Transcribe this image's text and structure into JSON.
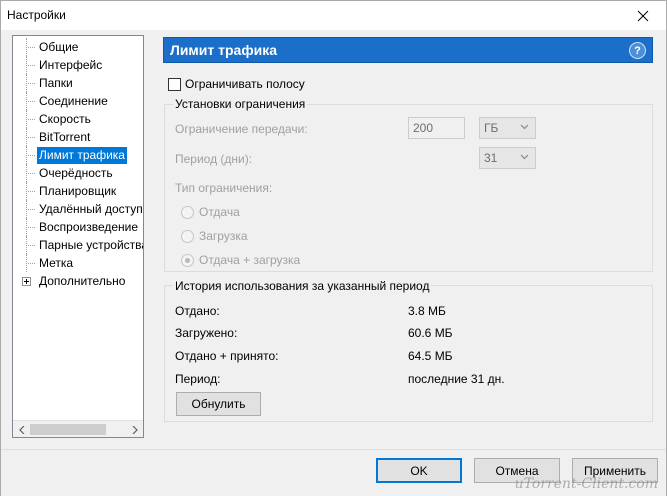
{
  "window": {
    "title": "Настройки",
    "accent_color": "#1b6fc9",
    "selection_color": "#0078d7"
  },
  "sidebar": {
    "items": [
      {
        "label": "Общие",
        "selected": false
      },
      {
        "label": "Интерфейс",
        "selected": false
      },
      {
        "label": "Папки",
        "selected": false
      },
      {
        "label": "Соединение",
        "selected": false
      },
      {
        "label": "Скорость",
        "selected": false
      },
      {
        "label": "BitTorrent",
        "selected": false
      },
      {
        "label": "Лимит трафика",
        "selected": true
      },
      {
        "label": "Очерёдность",
        "selected": false
      },
      {
        "label": "Планировщик",
        "selected": false
      },
      {
        "label": "Удалённый доступ",
        "selected": false
      },
      {
        "label": "Воспроизведение",
        "selected": false
      },
      {
        "label": "Парные устройства",
        "selected": false
      },
      {
        "label": "Метка",
        "selected": false
      },
      {
        "label": "Дополнительно",
        "selected": false,
        "expandable": true
      }
    ]
  },
  "panel": {
    "title": "Лимит трафика",
    "help": "?",
    "limit_checkbox": {
      "label": "Ограничивать полосу",
      "checked": false
    },
    "limits_group": {
      "title": "Установки ограничения",
      "transfer_label": "Ограничение передачи:",
      "transfer_value": "200",
      "transfer_unit": "ГБ",
      "period_label": "Период (дни):",
      "period_value": "31",
      "type_label": "Тип ограничения:",
      "radios": [
        {
          "label": "Отдача",
          "checked": false
        },
        {
          "label": "Загрузка",
          "checked": false
        },
        {
          "label": "Отдача + загрузка",
          "checked": true
        }
      ]
    },
    "history_group": {
      "title": "История использования за указанный период",
      "rows": [
        {
          "label": "Отдано:",
          "value": "3.8 МБ"
        },
        {
          "label": "Загружено:",
          "value": "60.6 МБ"
        },
        {
          "label": "Отдано + принято:",
          "value": "64.5 МБ"
        },
        {
          "label": "Период:",
          "value": "последние 31 дн."
        }
      ],
      "reset_label": "Обнулить"
    }
  },
  "footer": {
    "ok_label": "OK",
    "cancel_label": "Отмена",
    "apply_label": "Применить",
    "watermark": "uTorrent-Client.com"
  }
}
